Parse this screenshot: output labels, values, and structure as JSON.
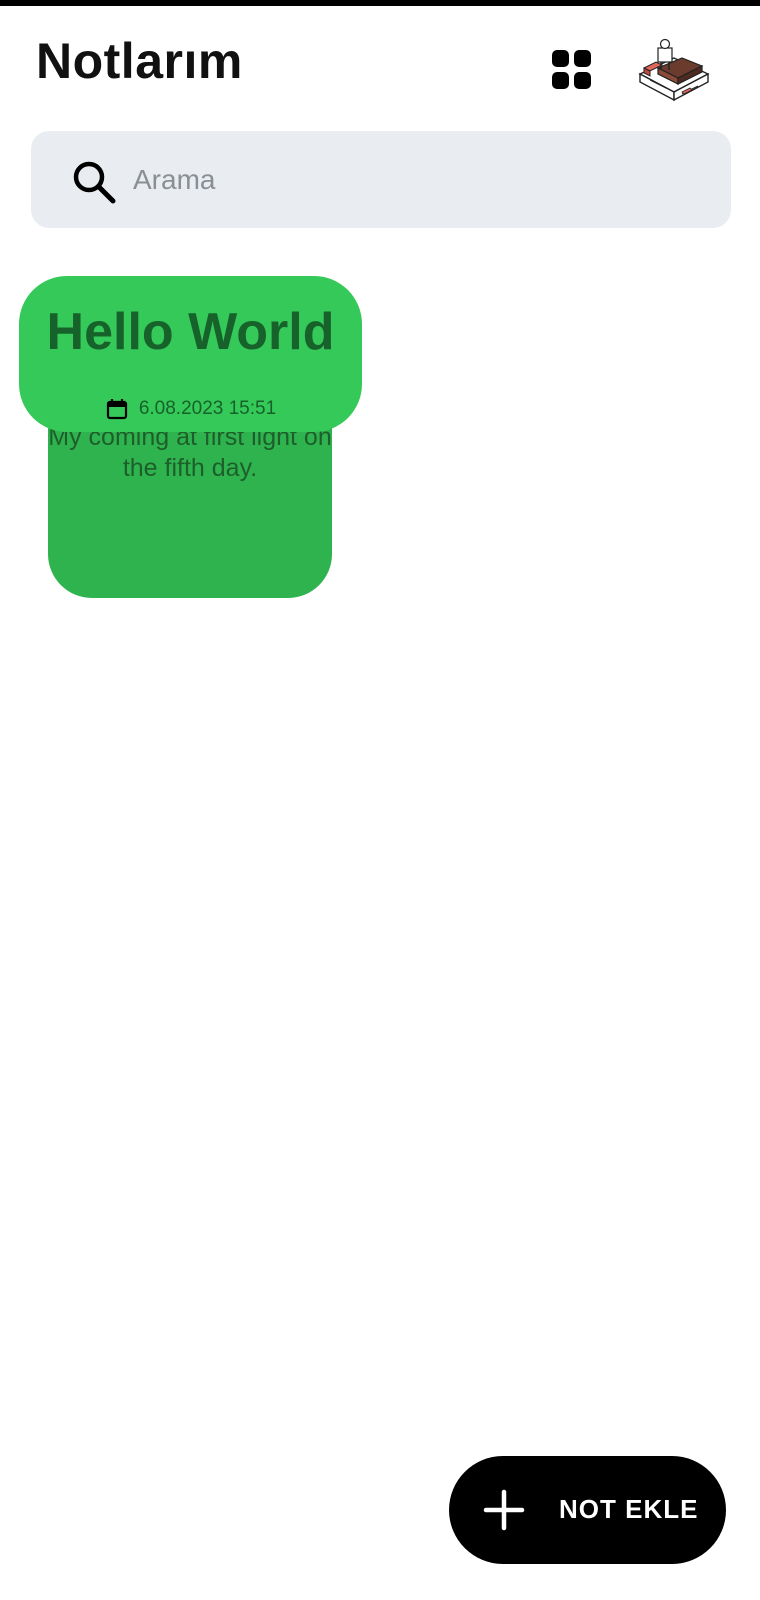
{
  "header": {
    "title": "Notlarım",
    "grid_icon": "grid-view-icon",
    "avatar_icon": "avatar-illustration"
  },
  "search": {
    "placeholder": "Arama",
    "value": "",
    "icon": "search-icon"
  },
  "notes": [
    {
      "title": "Hello World",
      "date": "6.08.2023 15:51",
      "body": "My coming at first light on the fifth day.",
      "head_color": "#35c95a",
      "body_color": "#2fb34f"
    }
  ],
  "fab": {
    "label": "NOT EKLE",
    "icon": "plus-icon"
  },
  "colors": {
    "background": "#ffffff",
    "search_bg": "#e9edf1",
    "fab_bg": "#000000",
    "note_text": "#17622a"
  }
}
